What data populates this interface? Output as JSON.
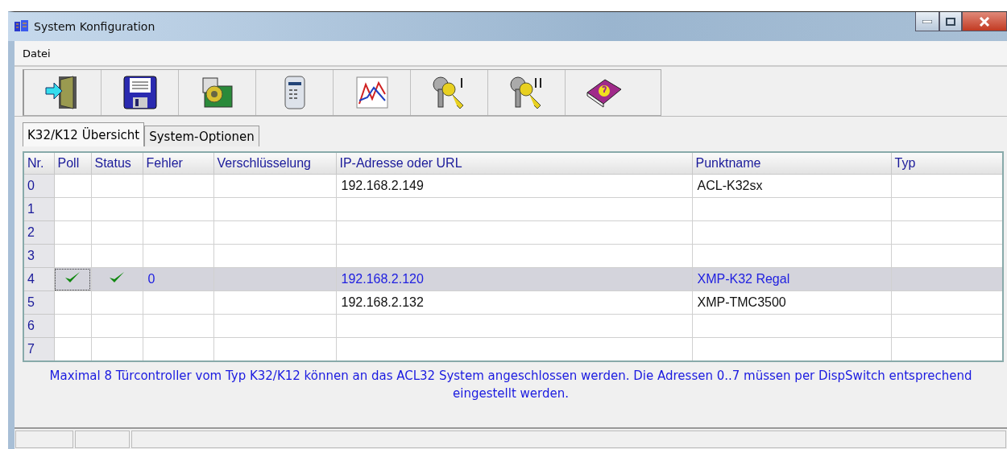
{
  "window": {
    "title": "System Konfiguration"
  },
  "menu": [
    "Datei"
  ],
  "toolbar": [
    {
      "kind": "exit"
    },
    {
      "kind": "save"
    },
    {
      "kind": "board"
    },
    {
      "kind": "keypad"
    },
    {
      "kind": "graph"
    },
    {
      "kind": "key1"
    },
    {
      "kind": "key2"
    },
    {
      "kind": "help"
    }
  ],
  "tabs": [
    {
      "label": "K32/K12 Übersicht",
      "selected": true
    },
    {
      "label": "System-Optionen",
      "selected": false
    }
  ],
  "table": {
    "columns": [
      "Nr.",
      "Poll",
      "Status",
      "Fehler",
      "Verschlüsselung",
      "IP-Adresse oder URL",
      "Punktname",
      "Typ"
    ],
    "rows": [
      {
        "nr": "0",
        "poll": false,
        "status": false,
        "fehler": "",
        "ip": "192.168.2.149",
        "name": "ACL-K32sx",
        "selected": false
      },
      {
        "nr": "1",
        "poll": false,
        "status": false,
        "fehler": "",
        "ip": "",
        "name": "",
        "selected": false
      },
      {
        "nr": "2",
        "poll": false,
        "status": false,
        "fehler": "",
        "ip": "",
        "name": "",
        "selected": false
      },
      {
        "nr": "3",
        "poll": false,
        "status": false,
        "fehler": "",
        "ip": "",
        "name": "",
        "selected": false
      },
      {
        "nr": "4",
        "poll": true,
        "status": true,
        "fehler": "0",
        "ip": "192.168.2.120",
        "name": "XMP-K32 Regal",
        "selected": true
      },
      {
        "nr": "5",
        "poll": false,
        "status": false,
        "fehler": "",
        "ip": "192.168.2.132",
        "name": "XMP-TMC3500",
        "selected": false
      },
      {
        "nr": "6",
        "poll": false,
        "status": false,
        "fehler": "",
        "ip": "",
        "name": "",
        "selected": false
      },
      {
        "nr": "7",
        "poll": false,
        "status": false,
        "fehler": "",
        "ip": "",
        "name": "",
        "selected": false
      }
    ]
  },
  "note": "Maximal 8 Türcontroller vom Typ K32/K12 können an das ACL32 System angeschlossen werden. Die Adressen 0..7 müssen per DispSwitch entsprechend eingestellt werden."
}
